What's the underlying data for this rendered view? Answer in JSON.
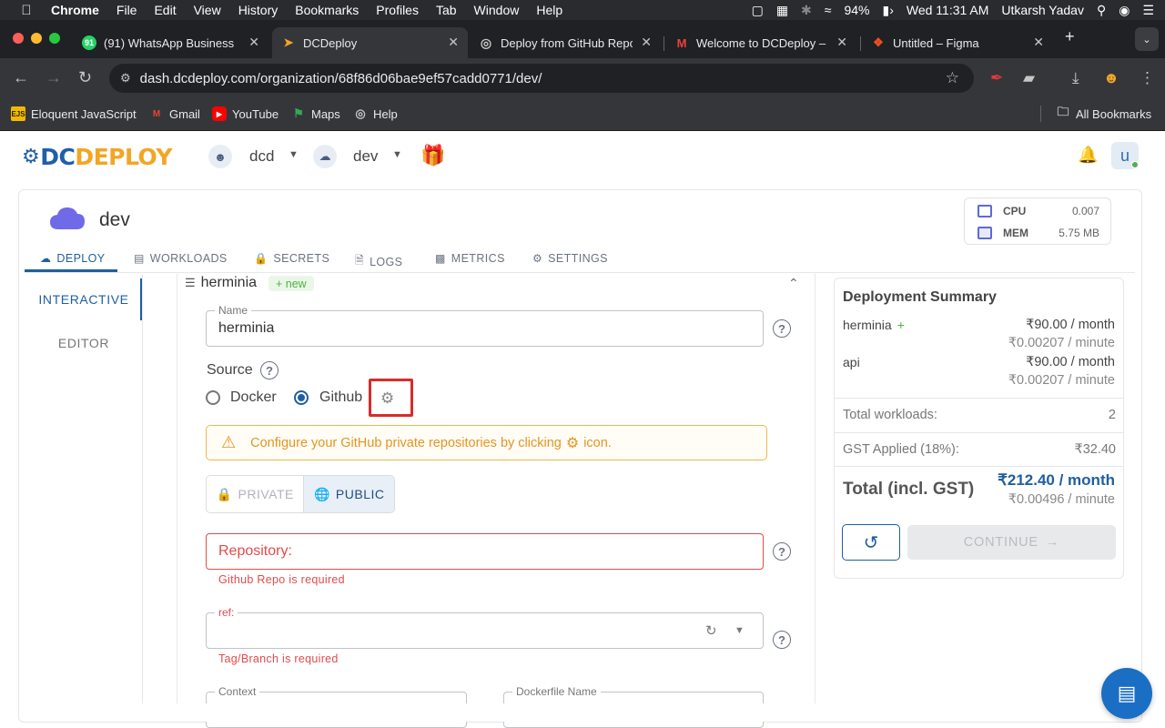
{
  "menubar": {
    "app": "Chrome",
    "items": [
      "File",
      "Edit",
      "View",
      "History",
      "Bookmarks",
      "Profiles",
      "Tab",
      "Window",
      "Help"
    ],
    "battery": "94%",
    "clock": "Wed 11:31 AM",
    "user": "Utkarsh Yadav"
  },
  "tabs": [
    {
      "title": "(91) WhatsApp Business",
      "badge": "91"
    },
    {
      "title": "DCDeploy"
    },
    {
      "title": "Deploy from GitHub Repo"
    },
    {
      "title": "Welcome to DCDeploy – A"
    },
    {
      "title": "Untitled – Figma"
    }
  ],
  "url": "dash.dcdeploy.com/organization/68f86d06bae9ef57cadd0771/dev/",
  "bookmarks": {
    "items": [
      "Eloquent JavaScript",
      "Gmail",
      "YouTube",
      "Maps",
      "Help"
    ],
    "all": "All Bookmarks"
  },
  "header": {
    "logo_dc": "DC",
    "logo_deploy": "DEPLOY",
    "org": "dcd",
    "env": "dev",
    "avatar_initial": "u"
  },
  "env": {
    "title": "dev",
    "cpu_label": "CPU",
    "cpu_value": "0.007",
    "mem_label": "MEM",
    "mem_value": "5.75 MB"
  },
  "nav_tabs": [
    "DEPLOY",
    "WORKLOADS",
    "SECRETS",
    "LOGS",
    "METRICS",
    "SETTINGS"
  ],
  "modes": [
    "INTERACTIVE",
    "EDITOR"
  ],
  "workload": {
    "name": "herminia",
    "badge": "+ new",
    "name_label": "Name",
    "name_value": "herminia",
    "source_label": "Source",
    "source_options": [
      "Docker",
      "Github"
    ],
    "source_selected": "Github",
    "warning_before": "Configure your GitHub private repositories by clicking",
    "warning_after": "icon.",
    "visibility": [
      "PRIVATE",
      "PUBLIC"
    ],
    "visibility_selected": "PUBLIC",
    "repo_placeholder": "Repository:",
    "repo_error": "Github Repo is required",
    "ref_label": "ref:",
    "ref_error": "Tag/Branch is required",
    "context_label": "Context",
    "dockerfile_label": "Dockerfile Name"
  },
  "summary": {
    "title": "Deployment Summary",
    "items": [
      {
        "name": "herminia",
        "new": "+",
        "price": "₹90.00 / month",
        "per_minute": "₹0.00207 / minute"
      },
      {
        "name": "api",
        "new": "",
        "price": "₹90.00 / month",
        "per_minute": "₹0.00207 / minute"
      }
    ],
    "total_workloads_label": "Total workloads:",
    "total_workloads": "2",
    "gst_label": "GST Applied (18%):",
    "gst_value": "₹32.40",
    "total_label": "Total (incl. GST)",
    "total_month": "₹212.40 / month",
    "total_minute": "₹0.00496 / minute",
    "continue": "CONTINUE"
  },
  "colors": {
    "primary": "#1f5f9e",
    "error": "#e24b4b",
    "warning": "#e5941f",
    "success": "#52b043"
  }
}
